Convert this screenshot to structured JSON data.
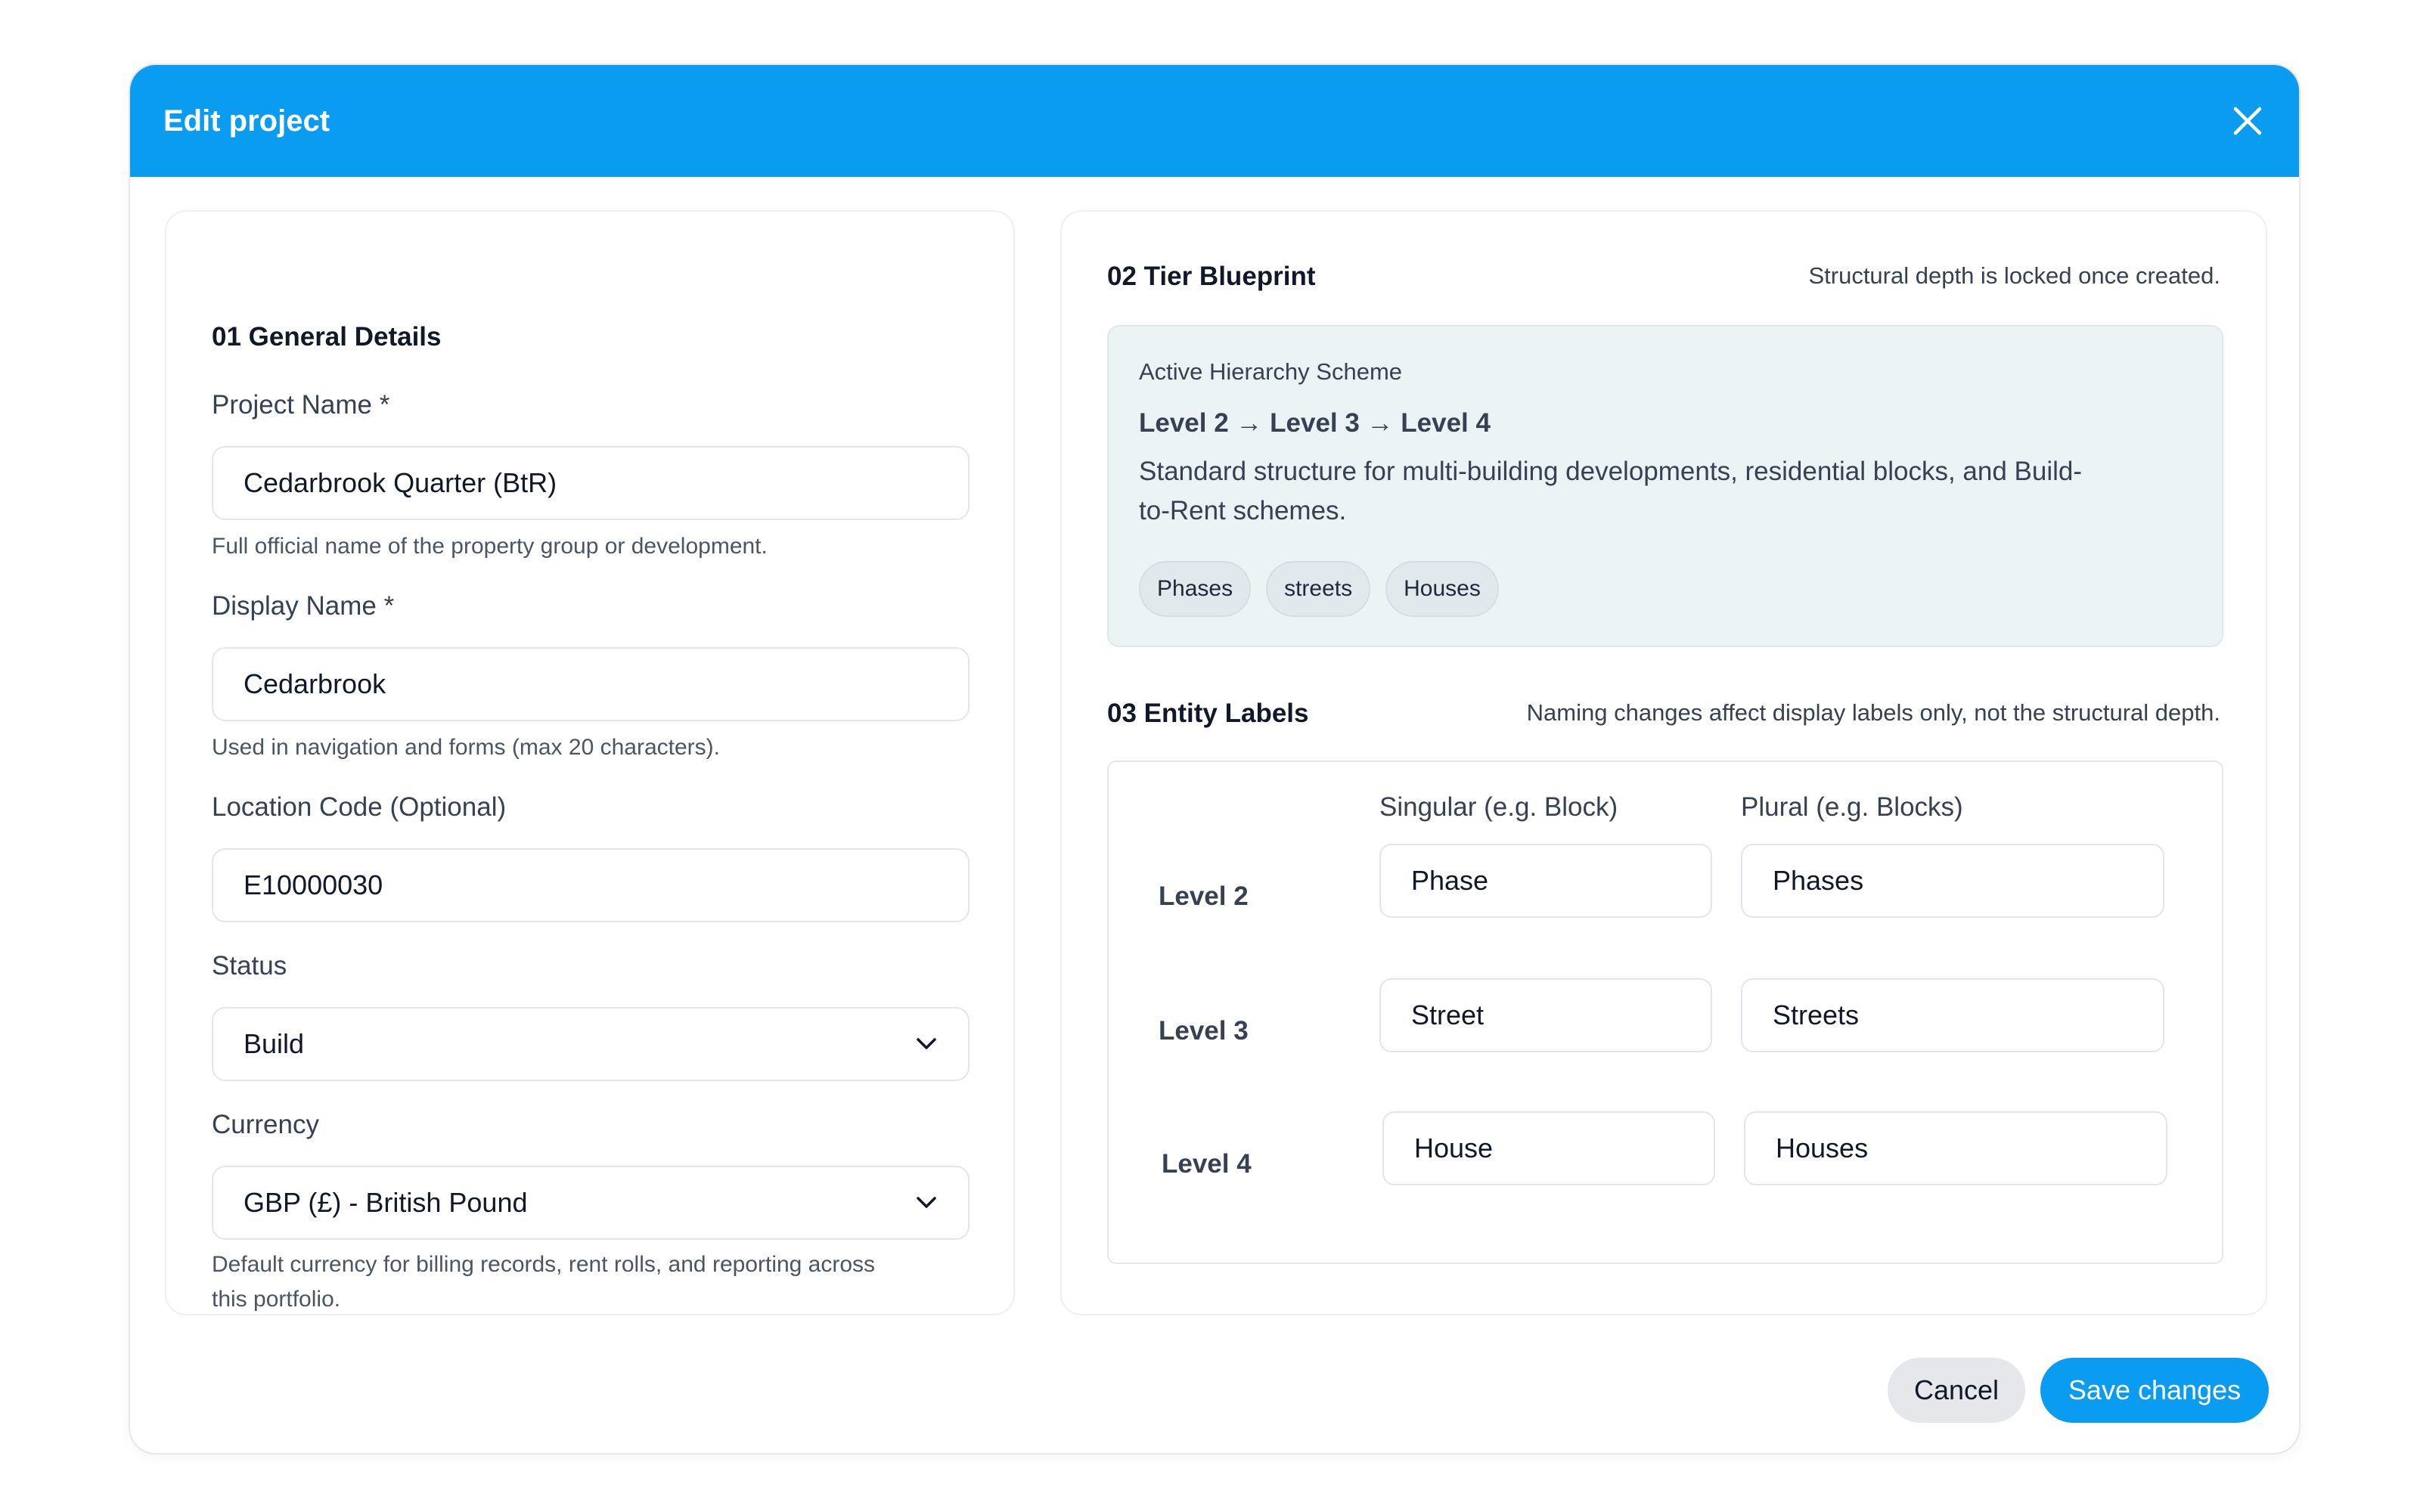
{
  "modal": {
    "title": "Edit project",
    "close_icon": "close-icon",
    "accent_color": "#0a9cf0"
  },
  "general": {
    "section_title": "01 General Details",
    "project_name": {
      "label": "Project Name *",
      "value": "Cedarbrook Quarter (BtR)",
      "help": "Full official name of the property group or development."
    },
    "display_name": {
      "label": "Display Name *",
      "value": "Cedarbrook",
      "help": "Used in navigation and forms (max 20 characters)."
    },
    "location_code": {
      "label": "Location Code (Optional)",
      "value": "E10000030"
    },
    "status": {
      "label": "Status",
      "value": "Build",
      "icon": "chevron-down-icon"
    },
    "currency": {
      "label": "Currency",
      "value": "GBP (£) - British Pound",
      "icon": "chevron-down-icon",
      "help_line1": "Default currency for billing records, rent rolls, and reporting across",
      "help_line2": "this portfolio."
    }
  },
  "tier": {
    "section_title": "02 Tier Blueprint",
    "note": "Structural depth is locked once created.",
    "scheme": {
      "caption": "Active Hierarchy Scheme",
      "path": "Level 2 → Level 3 → Level 4",
      "description_line1": "Standard structure for multi-building developments, residential blocks, and Build-",
      "description_line2": "to-Rent schemes.",
      "tags": [
        "Phases",
        "streets",
        "Houses"
      ]
    }
  },
  "entity": {
    "section_title": "03 Entity Labels",
    "note": "Naming changes affect display labels only, not the structural depth.",
    "col_singular": "Singular (e.g. Block)",
    "col_plural": "Plural (e.g. Blocks)",
    "rows": [
      {
        "level": "Level 2",
        "singular": "Phase",
        "plural": "Phases"
      },
      {
        "level": "Level 3",
        "singular": "Street",
        "plural": "Streets"
      },
      {
        "level": "Level 4",
        "singular": "House",
        "plural": "Houses"
      }
    ]
  },
  "footer": {
    "cancel_label": "Cancel",
    "save_label": "Save changes"
  }
}
